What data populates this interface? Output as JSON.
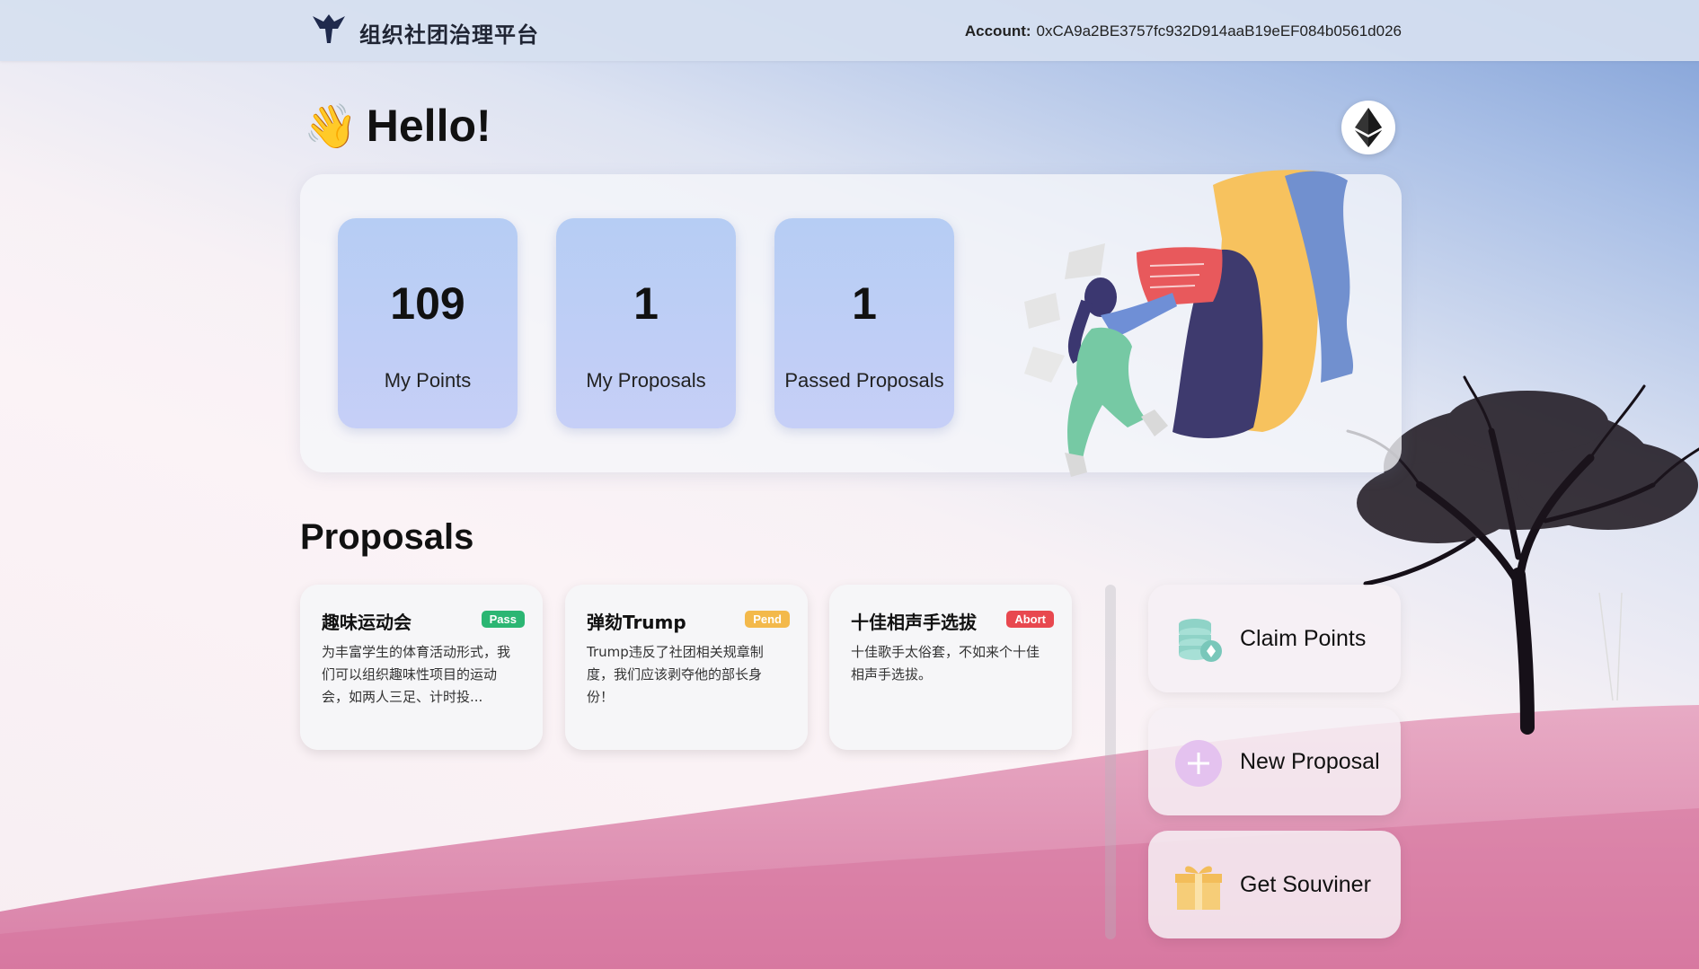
{
  "header": {
    "brand": "组织社团治理平台",
    "account_label": "Account:",
    "account_value": "0xCA9a2BE3757fc932D914aaB19eEF084b0561d026"
  },
  "greeting": {
    "emoji": "👋",
    "text": "Hello!"
  },
  "stats": [
    {
      "value": "109",
      "label": "My Points"
    },
    {
      "value": "1",
      "label": "My Proposals"
    },
    {
      "value": "1",
      "label": "Passed Proposals"
    }
  ],
  "proposals": {
    "title": "Proposals",
    "items": [
      {
        "title": "趣味运动会",
        "status": "Pass",
        "status_color": "#2bb673",
        "desc": "为丰富学生的体育活动形式，我们可以组织趣味性项目的运动会，如两人三足、计时投..."
      },
      {
        "title": "弹劾Trump",
        "status": "Pend",
        "status_color": "#f3b94b",
        "desc": "Trump违反了社团相关规章制度，我们应该剥夺他的部长身份！"
      },
      {
        "title": "十佳相声手选拔",
        "status": "Abort",
        "status_color": "#e8484f",
        "desc": "十佳歌手太俗套，不如来个十佳相声手选拔。"
      }
    ]
  },
  "actions": [
    {
      "label": "Claim Points",
      "icon": "coins-icon"
    },
    {
      "label": "New Proposal",
      "icon": "plus-circle-icon"
    },
    {
      "label": "Get Souviner",
      "icon": "gift-icon"
    }
  ],
  "icons": {
    "logo": "eagle-logo-icon",
    "network": "ethereum-icon"
  }
}
